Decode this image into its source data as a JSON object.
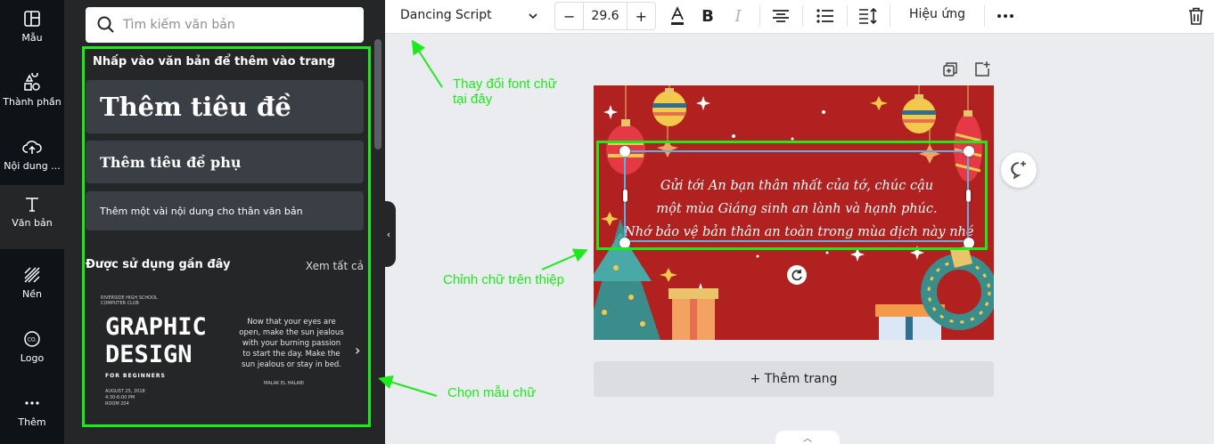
{
  "rail": {
    "items": [
      {
        "label": "Mẫu",
        "icon": "layout-icon"
      },
      {
        "label": "Thành phần",
        "icon": "shapes-icon"
      },
      {
        "label": "Nội dung ...",
        "icon": "cloud-upload-icon"
      },
      {
        "label": "Văn bản",
        "icon": "text-icon"
      },
      {
        "label": "Nền",
        "icon": "pattern-icon"
      },
      {
        "label": "Logo",
        "icon": "logo-icon"
      },
      {
        "label": "Thêm",
        "icon": "more-icon"
      }
    ]
  },
  "panel": {
    "search_placeholder": "Tìm kiếm văn bản",
    "hint": "Nhấp vào văn bản để thêm vào trang",
    "add_title": "Thêm tiêu đề",
    "add_subtitle": "Thêm tiêu đề phụ",
    "add_body": "Thêm một vài nội dung cho thân văn bản",
    "recent_heading": "Được sử dụng gần đây",
    "see_all": "Xem tất cả",
    "template": {
      "school": "RIVERSIDE HIGH SCHOOL",
      "club": "COMPUTER CLUB",
      "headline_1": "GRAPHIC",
      "headline_2": "DESIGN",
      "subline": "FOR BEGINNERS",
      "date": "AUGUST 25, 2018\n4:30-6:00 PM\nROOM 204",
      "quote": "Now that your eyes are open, make the sun jealous with your burning passion to start the day. Make the sun jealous or stay in bed.",
      "author": "MALAK EL HALABI"
    }
  },
  "toolbar": {
    "font": "Dancing Script",
    "font_size": "29.6",
    "minus": "−",
    "plus": "+",
    "effects": "Hiệu ứng"
  },
  "canvas": {
    "card_lines": [
      "Gửi tới An bạn thân nhất của tớ, chúc cậu",
      "một mùa Giáng sinh an lành và hạnh phúc.",
      "Nhớ bảo vệ bản thân an toàn trong mùa dịch này nhé"
    ],
    "add_page": "+ Thêm trang"
  },
  "annotations": {
    "font_hint_1": "Thay đổi font chữ",
    "font_hint_2": "tại đây",
    "edit_hint": "Chỉnh chữ trên thiệp",
    "template_hint": "Chọn mẫu chữ"
  },
  "colors": {
    "highlight": "#1bea1b",
    "card_bg": "#b1211f",
    "rail_bg": "#0e1318",
    "panel_bg": "#252627"
  }
}
